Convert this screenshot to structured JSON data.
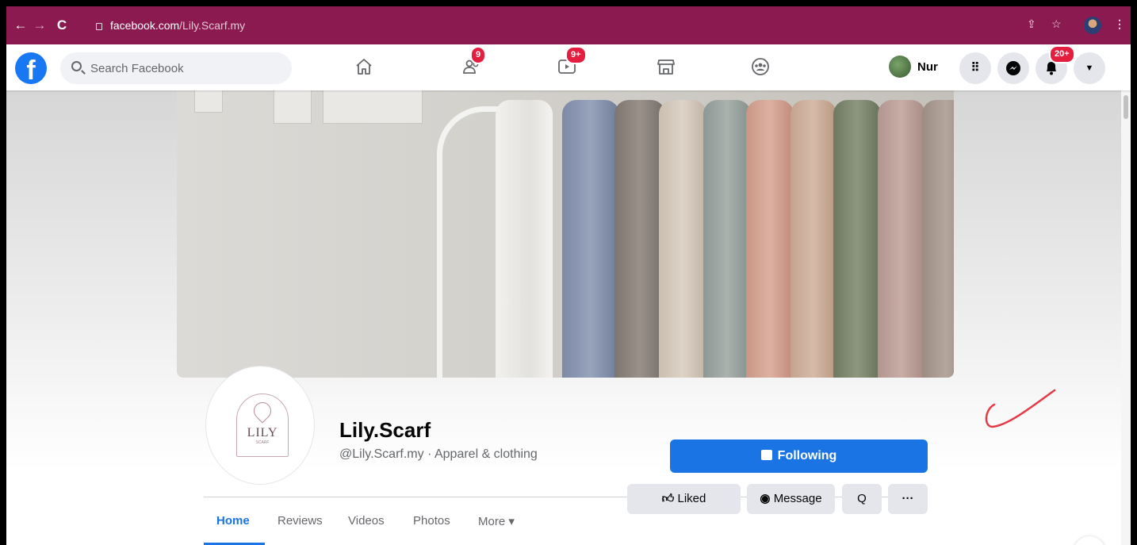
{
  "browser": {
    "url_host": "facebook.com",
    "url_path": "/Lily.Scarf.my"
  },
  "fb": {
    "logo": "f",
    "search_placeholder": "Search Facebook",
    "badges": {
      "friends": "9",
      "watch": "9+",
      "notifications": "20+"
    },
    "user_name": "Nur",
    "icons": [
      "home-icon",
      "friends-icon",
      "watch-icon",
      "marketplace-icon",
      "groups-icon",
      "menu-grid-icon",
      "messenger-icon",
      "bell-icon",
      "caret-down-icon"
    ]
  },
  "page": {
    "avatar_word": "LILY",
    "avatar_sub": "SCARF",
    "name": "Lily.Scarf",
    "handle": "@Lily.Scarf.my",
    "separator": " · ",
    "category": "Apparel & clothing",
    "following_label": "Following"
  },
  "tabs": [
    {
      "label": "Home",
      "active": true
    },
    {
      "label": "Reviews"
    },
    {
      "label": "Videos"
    },
    {
      "label": "Photos"
    },
    {
      "label": "More ▾"
    }
  ],
  "actions": {
    "liked": "Liked",
    "message": "Message",
    "search": "Q",
    "more": "···"
  },
  "colors": {
    "chrome": "#8a1a4f",
    "fb_blue": "#1b74e4",
    "badge_red": "#e41e3f",
    "annotation": "#e53945"
  }
}
